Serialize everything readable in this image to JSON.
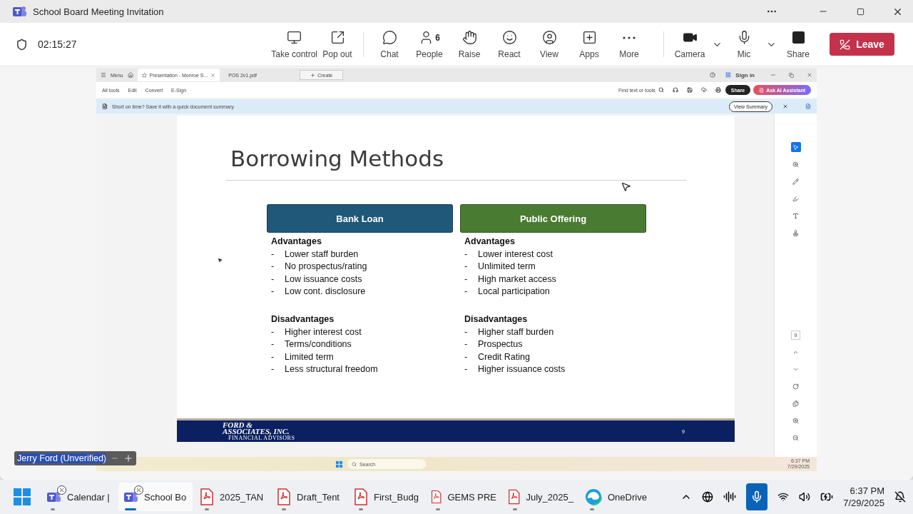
{
  "window": {
    "title": "School Board Meeting Invitation"
  },
  "meeting": {
    "timer": "02:15:27",
    "people_count": "6",
    "leave": "Leave",
    "toolbar": [
      {
        "label": "Take control",
        "has_menu": false
      },
      {
        "label": "Pop out",
        "has_menu": false
      },
      {
        "label": "Chat",
        "has_menu": false
      },
      {
        "label": "People",
        "has_menu": false
      },
      {
        "label": "Raise",
        "has_menu": false
      },
      {
        "label": "React",
        "has_menu": false
      },
      {
        "label": "View",
        "has_menu": false
      },
      {
        "label": "Apps",
        "has_menu": false
      },
      {
        "label": "More",
        "has_menu": false
      },
      {
        "label": "Camera",
        "has_menu": true
      },
      {
        "label": "Mic",
        "has_menu": true
      },
      {
        "label": "Share",
        "has_menu": false
      }
    ]
  },
  "shared_screen": {
    "menu": "Menu",
    "tabs": [
      {
        "label": "Presentation - Monroe S...",
        "selected": true
      },
      {
        "label": "POS 2v1.pdf",
        "selected": false
      }
    ],
    "create": "Create",
    "sign_in": "Sign in",
    "tools": [
      "All tools",
      "Edit",
      "Convert",
      "E-Sign"
    ],
    "find": "Find text or tools",
    "share": "Share",
    "ai_assistant": "Ask AI Assistant",
    "banner": "Short on time? Save it with a quick document summary.",
    "view_summary": "View Summary",
    "page_indicator": "9",
    "slide": {
      "title": "Borrowing Methods",
      "columns": [
        {
          "header": "Bank Loan",
          "color": "#1f5878",
          "sections": [
            {
              "heading": "Advantages",
              "items": [
                {
                  "marker": "-",
                  "text": "Lower staff burden"
                },
                {
                  "marker": "-",
                  "text": "No prospectus/rating"
                },
                {
                  "marker": "-",
                  "text": "Low issuance costs"
                },
                {
                  "marker": "-",
                  "text": "Low cont. disclosure"
                }
              ]
            },
            {
              "heading": "Disadvantages",
              "items": [
                {
                  "marker": "-",
                  "text": "Higher interest cost"
                },
                {
                  "marker": "-",
                  "text": "Terms/conditions"
                },
                {
                  "marker": "-",
                  "text": "Limited term"
                },
                {
                  "marker": "-",
                  "text": "Less structural freedom"
                }
              ]
            }
          ]
        },
        {
          "header": "Public Offering",
          "color": "#4a7b32",
          "sections": [
            {
              "heading": "Advantages",
              "items": [
                {
                  "marker": "-",
                  "text": "Lower interest cost"
                },
                {
                  "marker": "-",
                  "text": "Unlimited term"
                },
                {
                  "marker": "-",
                  "text": "High market access"
                },
                {
                  "marker": "-",
                  "text": "Local participation"
                }
              ]
            },
            {
              "heading": "Disadvantages",
              "items": [
                {
                  "marker": "-",
                  "text": "Higher staff burden"
                },
                {
                  "marker": "-",
                  "text": "Prospectus"
                },
                {
                  "marker": "-",
                  "text": "Credit Rating"
                },
                {
                  "marker": "-",
                  "text": "Higher issuance costs"
                }
              ]
            }
          ]
        }
      ],
      "logo": {
        "line_1": "FORD & ",
        "line_2": "ASSOCIATES, INC.",
        "line_3": "FINANCIAL ADVISORS"
      },
      "page": "9"
    },
    "remote_taskbar": {
      "search": "Search",
      "time": "6:37 PM",
      "date": "7/29/2025"
    }
  },
  "presenter": {
    "name": "Jerry Ford (Unverified)"
  },
  "taskbar": {
    "apps": [
      {
        "label": "Calendar |",
        "kind": "teams",
        "selected": false
      },
      {
        "label": "School Bo",
        "kind": "teams",
        "selected": true
      },
      {
        "label": "2025_TAN",
        "kind": "pdf",
        "selected": false
      },
      {
        "label": "Draft_Tent",
        "kind": "pdf",
        "selected": false
      },
      {
        "label": "First_Budg",
        "kind": "pdf",
        "selected": false
      },
      {
        "label": "GEMS PRE",
        "kind": "pdf",
        "selected": false
      },
      {
        "label": "July_2025_",
        "kind": "pdf",
        "selected": false
      },
      {
        "label": "OneDrive",
        "kind": "edge",
        "selected": false
      }
    ],
    "time": "6:37 PM",
    "date": "7/29/2025"
  }
}
